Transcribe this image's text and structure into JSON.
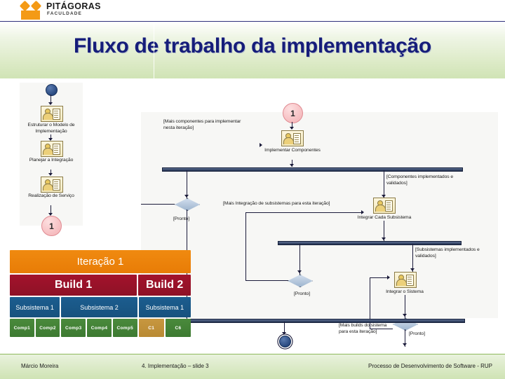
{
  "brand": {
    "name": "PITÁGORAS",
    "subtitle": "FACULDADE",
    "accent": "#F49A16"
  },
  "header": {
    "title": "Fluxo de trabalho da implementação",
    "title_color": "#161d7a"
  },
  "diagram": {
    "left_column": {
      "activities": [
        "Estruturar o Modelo de Implementação",
        "Planejar a Integração",
        "Realização de Serviço"
      ],
      "end_marker": "1"
    },
    "main": {
      "start_marker": "1",
      "activities": [
        "Implementar Componentes",
        "Integrar Cada Subsistema",
        "Integrar o Sistema"
      ],
      "guards": [
        "[Mais componentes para implementar nesta iteração]",
        "[Pronto]",
        "[Componentes implementados e validados]",
        "[Mais Integração de subsistemas para esta iteração]",
        "[Pronto]",
        "[Subsistemas implementados e validados]",
        "[Mais builds do sistema para esta iteração]",
        "[Pronto]"
      ]
    }
  },
  "build_table": {
    "iteration": "Iteração 1",
    "builds": [
      {
        "label": "Build 1",
        "flex": 546
      },
      {
        "label": "Build 2",
        "flex": 225
      }
    ],
    "subsystems": [
      {
        "label": "Subsistema 1",
        "flex": 216
      },
      {
        "label": "Subsistema 2",
        "flex": 328
      },
      {
        "label": "Subsistema 1",
        "flex": 225
      }
    ],
    "components": [
      {
        "label": "Comp1",
        "color": "green"
      },
      {
        "label": "Comp2",
        "color": "green"
      },
      {
        "label": "Comp3",
        "color": "green"
      },
      {
        "label": "Comp4",
        "color": "green"
      },
      {
        "label": "Comp5",
        "color": "green"
      },
      {
        "label": "C1",
        "color": "tan"
      },
      {
        "label": "C6",
        "color": "green"
      }
    ],
    "colors": {
      "iteration": "#ef8410",
      "build": "#9b1229",
      "subsystem": "#1a5a8b",
      "component": "#44833a",
      "component_alt": "#c09139"
    }
  },
  "footer": {
    "author": "Márcio Moreira",
    "section": "4. Implementação – slide 3",
    "course": "Processo de Desenvolvimento de Software - RUP"
  }
}
